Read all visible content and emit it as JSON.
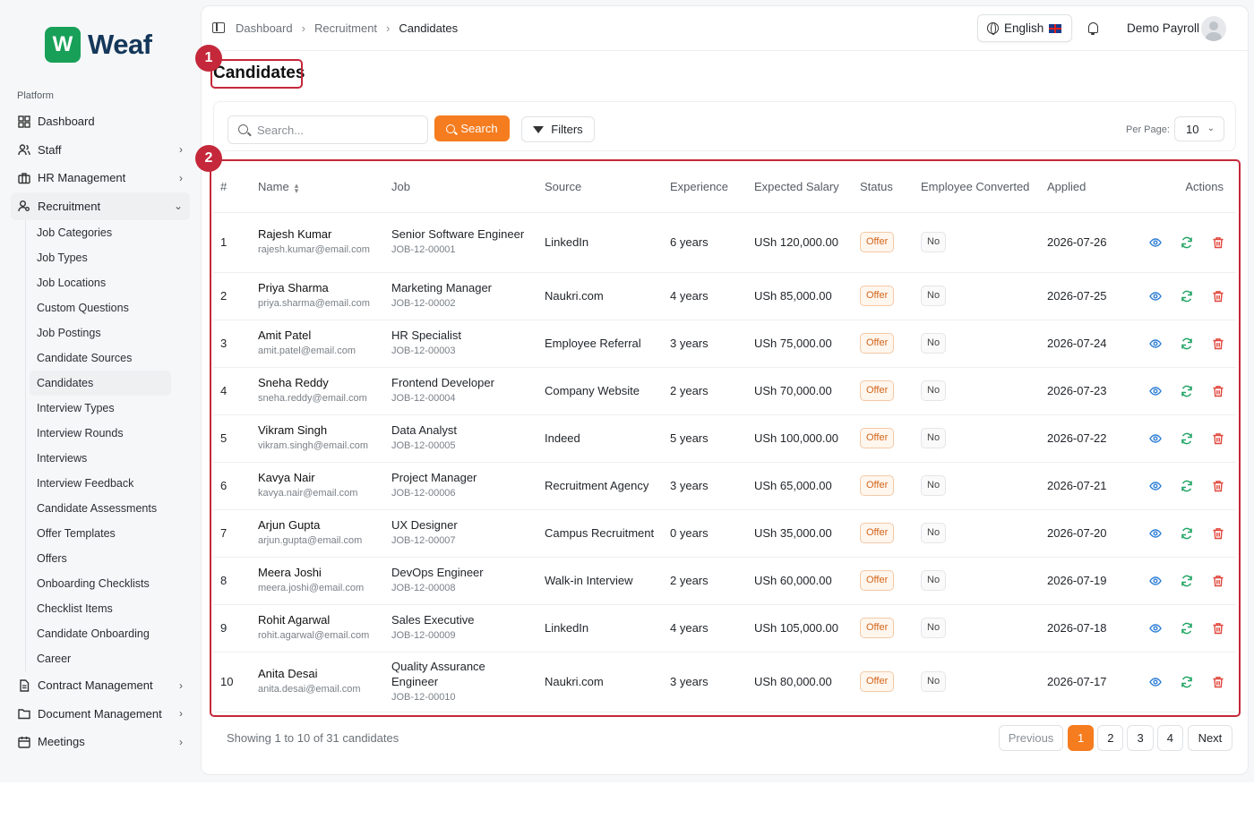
{
  "brand": {
    "logo_letter": "W",
    "name": "Weaf"
  },
  "sidebar": {
    "section_label": "Platform",
    "items": [
      {
        "label": "Dashboard",
        "icon": "grid-icon",
        "chevron": false
      },
      {
        "label": "Staff",
        "icon": "users-icon",
        "chevron": true
      },
      {
        "label": "HR Management",
        "icon": "briefcase-icon",
        "chevron": true
      },
      {
        "label": "Recruitment",
        "icon": "user-search-icon",
        "chevron": true,
        "expanded": true
      }
    ],
    "recruitment_subitems": [
      "Job Categories",
      "Job Types",
      "Job Locations",
      "Custom Questions",
      "Job Postings",
      "Candidate Sources",
      "Candidates",
      "Interview Types",
      "Interview Rounds",
      "Interviews",
      "Interview Feedback",
      "Candidate Assessments",
      "Offer Templates",
      "Offers",
      "Onboarding Checklists",
      "Checklist Items",
      "Candidate Onboarding",
      "Career"
    ],
    "bottom_items": [
      {
        "label": "Contract Management",
        "icon": "file-icon"
      },
      {
        "label": "Document Management",
        "icon": "folder-icon"
      },
      {
        "label": "Meetings",
        "icon": "calendar-icon"
      }
    ]
  },
  "topbar": {
    "breadcrumb": [
      "Dashboard",
      "Recruitment",
      "Candidates"
    ],
    "language": "English",
    "user_name": "Demo Payroll"
  },
  "page": {
    "title": "Candidates",
    "annotations": [
      "1",
      "2"
    ]
  },
  "toolbar": {
    "search_placeholder": "Search...",
    "search_button": "Search",
    "filters_button": "Filters",
    "per_page_label": "Per Page:",
    "per_page_value": "10"
  },
  "table": {
    "headers": [
      "#",
      "Name",
      "Job",
      "Source",
      "Experience",
      "Expected Salary",
      "Status",
      "Employee Converted",
      "Applied",
      "Actions"
    ],
    "rows": [
      {
        "num": "1",
        "name": "Rajesh Kumar",
        "email": "rajesh.kumar@email.com",
        "job": "Senior Software Engineer",
        "job_id": "JOB-12-00001",
        "source": "LinkedIn",
        "experience": "6 years",
        "salary": "USh 120,000.00",
        "status": "Offer",
        "converted": "No",
        "applied": "2026-07-26"
      },
      {
        "num": "2",
        "name": "Priya Sharma",
        "email": "priya.sharma@email.com",
        "job": "Marketing Manager",
        "job_id": "JOB-12-00002",
        "source": "Naukri.com",
        "experience": "4 years",
        "salary": "USh 85,000.00",
        "status": "Offer",
        "converted": "No",
        "applied": "2026-07-25"
      },
      {
        "num": "3",
        "name": "Amit Patel",
        "email": "amit.patel@email.com",
        "job": "HR Specialist",
        "job_id": "JOB-12-00003",
        "source": "Employee Referral",
        "experience": "3 years",
        "salary": "USh 75,000.00",
        "status": "Offer",
        "converted": "No",
        "applied": "2026-07-24"
      },
      {
        "num": "4",
        "name": "Sneha Reddy",
        "email": "sneha.reddy@email.com",
        "job": "Frontend Developer",
        "job_id": "JOB-12-00004",
        "source": "Company Website",
        "experience": "2 years",
        "salary": "USh 70,000.00",
        "status": "Offer",
        "converted": "No",
        "applied": "2026-07-23"
      },
      {
        "num": "5",
        "name": "Vikram Singh",
        "email": "vikram.singh@email.com",
        "job": "Data Analyst",
        "job_id": "JOB-12-00005",
        "source": "Indeed",
        "experience": "5 years",
        "salary": "USh 100,000.00",
        "status": "Offer",
        "converted": "No",
        "applied": "2026-07-22"
      },
      {
        "num": "6",
        "name": "Kavya Nair",
        "email": "kavya.nair@email.com",
        "job": "Project Manager",
        "job_id": "JOB-12-00006",
        "source": "Recruitment Agency",
        "experience": "3 years",
        "salary": "USh 65,000.00",
        "status": "Offer",
        "converted": "No",
        "applied": "2026-07-21"
      },
      {
        "num": "7",
        "name": "Arjun Gupta",
        "email": "arjun.gupta@email.com",
        "job": "UX Designer",
        "job_id": "JOB-12-00007",
        "source": "Campus Recruitment",
        "experience": "0 years",
        "salary": "USh 35,000.00",
        "status": "Offer",
        "converted": "No",
        "applied": "2026-07-20"
      },
      {
        "num": "8",
        "name": "Meera Joshi",
        "email": "meera.joshi@email.com",
        "job": "DevOps Engineer",
        "job_id": "JOB-12-00008",
        "source": "Walk-in Interview",
        "experience": "2 years",
        "salary": "USh 60,000.00",
        "status": "Offer",
        "converted": "No",
        "applied": "2026-07-19"
      },
      {
        "num": "9",
        "name": "Rohit Agarwal",
        "email": "rohit.agarwal@email.com",
        "job": "Sales Executive",
        "job_id": "JOB-12-00009",
        "source": "LinkedIn",
        "experience": "4 years",
        "salary": "USh 105,000.00",
        "status": "Offer",
        "converted": "No",
        "applied": "2026-07-18"
      },
      {
        "num": "10",
        "name": "Anita Desai",
        "email": "anita.desai@email.com",
        "job": "Quality Assurance Engineer",
        "job_id": "JOB-12-00010",
        "source": "Naukri.com",
        "experience": "3 years",
        "salary": "USh 80,000.00",
        "status": "Offer",
        "converted": "No",
        "applied": "2026-07-17"
      }
    ]
  },
  "footer": {
    "showing_text": "Showing 1 to 10 of 31 candidates",
    "previous": "Previous",
    "pages": [
      "1",
      "2",
      "3",
      "4"
    ],
    "active_page": "1",
    "next": "Next"
  },
  "colors": {
    "accent": "#f57c1f",
    "brand": "#18a058",
    "annotation": "#c4283a",
    "view_icon": "#2f7fd6",
    "convert_icon": "#1fa463",
    "delete_icon": "#e0453a"
  }
}
